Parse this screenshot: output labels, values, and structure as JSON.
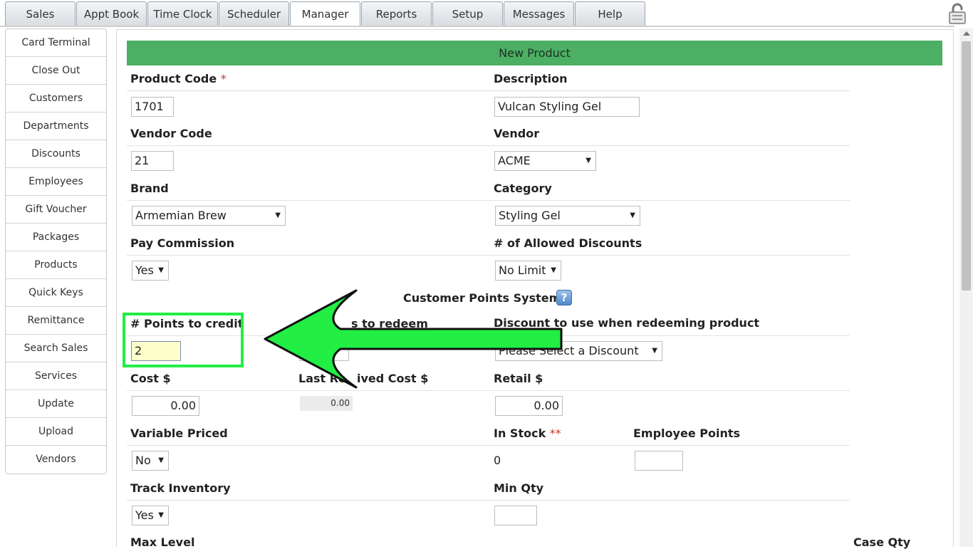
{
  "tabs": [
    "Sales",
    "Appt Book",
    "Time Clock",
    "Scheduler",
    "Manager",
    "Reports",
    "Setup",
    "Messages",
    "Help"
  ],
  "active_tab": "Manager",
  "sidebar": {
    "items": [
      "Card Terminal",
      "Close Out",
      "Customers",
      "Departments",
      "Discounts",
      "Employees",
      "Gift Voucher",
      "Packages",
      "Products",
      "Quick Keys",
      "Remittance",
      "Search Sales",
      "Services",
      "Update",
      "Upload",
      "Vendors"
    ]
  },
  "form": {
    "title": "New Product",
    "product_code": {
      "label": "Product Code",
      "required_mark": "*",
      "value": "1701"
    },
    "description": {
      "label": "Description",
      "value": "Vulcan Styling Gel"
    },
    "vendor_code": {
      "label": "Vendor Code",
      "value": "21"
    },
    "vendor": {
      "label": "Vendor",
      "value": "ACME"
    },
    "brand": {
      "label": "Brand",
      "value": "Armemian Brew"
    },
    "category": {
      "label": "Category",
      "value": "Styling Gel"
    },
    "pay_commission": {
      "label": "Pay Commission",
      "value": "Yes"
    },
    "allowed_discounts": {
      "label": "# of Allowed Discounts",
      "value": "No Limit"
    },
    "points_section": {
      "title": "Customer Points System",
      "help": "?"
    },
    "points_credit": {
      "label": "# Points to credit",
      "value": "2"
    },
    "points_redeem": {
      "label_left": "#",
      "label_right": "s to redeem"
    },
    "redeem_discount": {
      "label": "Discount to use when redeeming product",
      "value": "Please Select a Discount"
    },
    "cost": {
      "label": "Cost $",
      "value": "0.00"
    },
    "last_received_cost": {
      "label_left": "Last Re",
      "label_right": "ived Cost $",
      "value": "0.00"
    },
    "retail": {
      "label": "Retail $",
      "value": "0.00"
    },
    "variable_priced": {
      "label": "Variable Priced",
      "value": "No"
    },
    "in_stock": {
      "label": "In Stock",
      "required_mark": "**",
      "value": "0"
    },
    "employee_points": {
      "label": "Employee Points",
      "value": ""
    },
    "track_inventory": {
      "label": "Track Inventory",
      "value": "Yes"
    },
    "min_qty": {
      "label": "Min Qty",
      "value": ""
    },
    "max_level": {
      "label": "Max Level"
    },
    "case_qty": {
      "label": "Case Qty"
    }
  },
  "colors": {
    "header_green": "#4caf64",
    "callout_green": "#22ee44",
    "highlight_yellow": "#ffffcc"
  },
  "icons": {
    "lock": "lock-icon",
    "help": "help-icon",
    "callout": "arrow-left-icon"
  }
}
